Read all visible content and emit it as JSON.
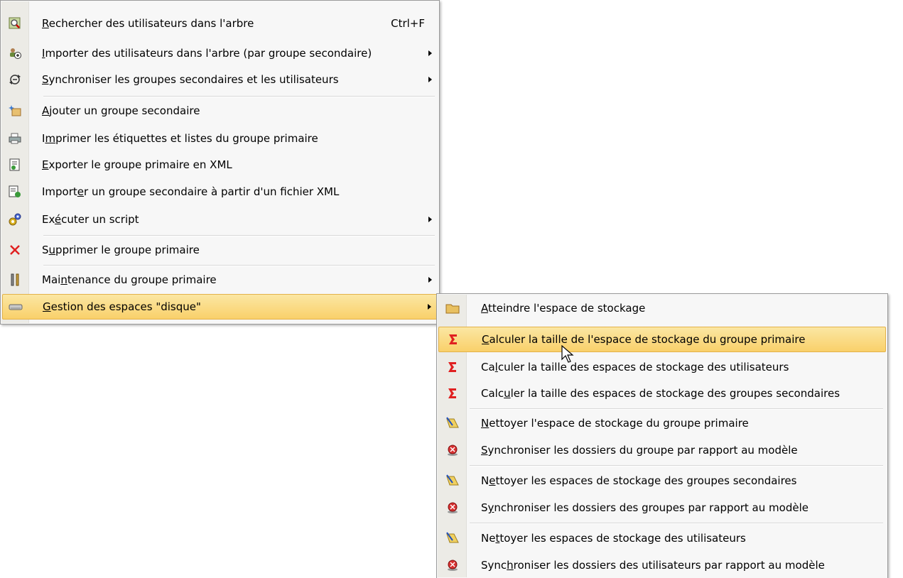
{
  "main_menu": {
    "items": [
      {
        "label_pre": "",
        "label_u": "R",
        "label_post": "echercher des utilisateurs dans l'arbre",
        "shortcut": "Ctrl+F",
        "icon": "search-users-icon",
        "submenu": false
      },
      {
        "label_pre": "",
        "label_u": "I",
        "label_post": "mporter des utilisateurs dans l'arbre (par groupe secondaire)",
        "shortcut": "",
        "icon": "import-users-icon",
        "submenu": true
      },
      {
        "label_pre": "",
        "label_u": "S",
        "label_post": "ynchroniser les groupes secondaires et les utilisateurs",
        "shortcut": "",
        "icon": "sync-icon",
        "submenu": true
      },
      {
        "label_pre": "",
        "label_u": "A",
        "label_post": "jouter un groupe secondaire",
        "shortcut": "",
        "icon": "add-group-icon",
        "submenu": false
      },
      {
        "label_pre": "I",
        "label_u": "m",
        "label_post": "primer les étiquettes et listes du groupe primaire",
        "shortcut": "",
        "icon": "printer-icon",
        "submenu": false
      },
      {
        "label_pre": "",
        "label_u": "E",
        "label_post": "xporter le groupe primaire en XML",
        "shortcut": "",
        "icon": "export-xml-icon",
        "submenu": false
      },
      {
        "label_pre": "Import",
        "label_u": "e",
        "label_post": "r un groupe secondaire à partir d'un fichier XML",
        "shortcut": "",
        "icon": "import-xml-icon",
        "submenu": false
      },
      {
        "label_pre": "Ex",
        "label_u": "é",
        "label_post": "cuter un script",
        "shortcut": "",
        "icon": "script-gears-icon",
        "submenu": true
      },
      {
        "label_pre": "S",
        "label_u": "u",
        "label_post": "pprimer le groupe primaire",
        "shortcut": "",
        "icon": "delete-x-icon",
        "submenu": false
      },
      {
        "label_pre": "Mai",
        "label_u": "n",
        "label_post": "tenance du groupe primaire",
        "shortcut": "",
        "icon": "maintenance-tools-icon",
        "submenu": true
      },
      {
        "label_pre": "",
        "label_u": "G",
        "label_post": "estion des espaces \"disque\"",
        "shortcut": "",
        "icon": "disk-drive-icon",
        "submenu": true
      }
    ]
  },
  "sub_menu": {
    "items": [
      {
        "label_pre": "",
        "label_u": "A",
        "label_post": "tteindre l'espace de stockage",
        "icon": "folder-icon"
      },
      {
        "label_pre": "",
        "label_u": "C",
        "label_post": "alculer la taille de l'espace de stockage du groupe primaire",
        "icon": "sigma-icon"
      },
      {
        "label_pre": "Ca",
        "label_u": "l",
        "label_post": "culer la taille des espaces de stockage des utilisateurs",
        "icon": "sigma-icon"
      },
      {
        "label_pre": "Calc",
        "label_u": "u",
        "label_post": "ler la taille des espaces de stockage des groupes secondaires",
        "icon": "sigma-icon"
      },
      {
        "label_pre": "",
        "label_u": "N",
        "label_post": "ettoyer l'espace de stockage du groupe primaire",
        "icon": "broom-clean-icon"
      },
      {
        "label_pre": "",
        "label_u": "S",
        "label_post": "ynchroniser les dossiers du groupe par rapport au modèle",
        "icon": "sync-folders-icon"
      },
      {
        "label_pre": "N",
        "label_u": "e",
        "label_post": "ttoyer les espaces de stockage des groupes secondaires",
        "icon": "broom-clean-icon"
      },
      {
        "label_pre": "S",
        "label_u": "y",
        "label_post": "nchroniser les dossiers des groupes par rapport au modèle",
        "icon": "sync-folders-icon"
      },
      {
        "label_pre": "Ne",
        "label_u": "t",
        "label_post": "toyer les espaces de stockage des utilisateurs",
        "icon": "broom-clean-icon"
      },
      {
        "label_pre": "Sync",
        "label_u": "h",
        "label_post": "roniser les dossiers des utilisateurs par rapport au modèle",
        "icon": "sync-folders-icon"
      }
    ]
  },
  "colors": {
    "highlight_top": "#fbe7a3",
    "highlight_bottom": "#f9d06a",
    "gutter": "#ecebe6"
  }
}
